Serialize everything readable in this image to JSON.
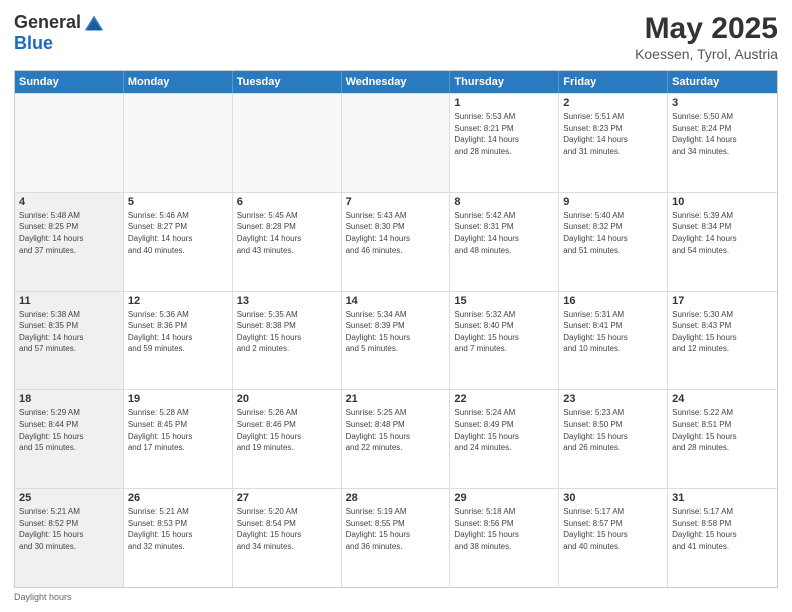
{
  "header": {
    "logo_general": "General",
    "logo_blue": "Blue",
    "main_title": "May 2025",
    "subtitle": "Koessen, Tyrol, Austria"
  },
  "weekdays": [
    "Sunday",
    "Monday",
    "Tuesday",
    "Wednesday",
    "Thursday",
    "Friday",
    "Saturday"
  ],
  "weeks": [
    [
      {
        "day": "",
        "info": "",
        "shaded": true
      },
      {
        "day": "",
        "info": "",
        "shaded": true
      },
      {
        "day": "",
        "info": "",
        "shaded": true
      },
      {
        "day": "",
        "info": "",
        "shaded": true
      },
      {
        "day": "1",
        "info": "Sunrise: 5:53 AM\nSunset: 8:21 PM\nDaylight: 14 hours\nand 28 minutes.",
        "shaded": false
      },
      {
        "day": "2",
        "info": "Sunrise: 5:51 AM\nSunset: 8:23 PM\nDaylight: 14 hours\nand 31 minutes.",
        "shaded": false
      },
      {
        "day": "3",
        "info": "Sunrise: 5:50 AM\nSunset: 8:24 PM\nDaylight: 14 hours\nand 34 minutes.",
        "shaded": false
      }
    ],
    [
      {
        "day": "4",
        "info": "Sunrise: 5:48 AM\nSunset: 8:25 PM\nDaylight: 14 hours\nand 37 minutes.",
        "shaded": true
      },
      {
        "day": "5",
        "info": "Sunrise: 5:46 AM\nSunset: 8:27 PM\nDaylight: 14 hours\nand 40 minutes.",
        "shaded": false
      },
      {
        "day": "6",
        "info": "Sunrise: 5:45 AM\nSunset: 8:28 PM\nDaylight: 14 hours\nand 43 minutes.",
        "shaded": false
      },
      {
        "day": "7",
        "info": "Sunrise: 5:43 AM\nSunset: 8:30 PM\nDaylight: 14 hours\nand 46 minutes.",
        "shaded": false
      },
      {
        "day": "8",
        "info": "Sunrise: 5:42 AM\nSunset: 8:31 PM\nDaylight: 14 hours\nand 48 minutes.",
        "shaded": false
      },
      {
        "day": "9",
        "info": "Sunrise: 5:40 AM\nSunset: 8:32 PM\nDaylight: 14 hours\nand 51 minutes.",
        "shaded": false
      },
      {
        "day": "10",
        "info": "Sunrise: 5:39 AM\nSunset: 8:34 PM\nDaylight: 14 hours\nand 54 minutes.",
        "shaded": false
      }
    ],
    [
      {
        "day": "11",
        "info": "Sunrise: 5:38 AM\nSunset: 8:35 PM\nDaylight: 14 hours\nand 57 minutes.",
        "shaded": true
      },
      {
        "day": "12",
        "info": "Sunrise: 5:36 AM\nSunset: 8:36 PM\nDaylight: 14 hours\nand 59 minutes.",
        "shaded": false
      },
      {
        "day": "13",
        "info": "Sunrise: 5:35 AM\nSunset: 8:38 PM\nDaylight: 15 hours\nand 2 minutes.",
        "shaded": false
      },
      {
        "day": "14",
        "info": "Sunrise: 5:34 AM\nSunset: 8:39 PM\nDaylight: 15 hours\nand 5 minutes.",
        "shaded": false
      },
      {
        "day": "15",
        "info": "Sunrise: 5:32 AM\nSunset: 8:40 PM\nDaylight: 15 hours\nand 7 minutes.",
        "shaded": false
      },
      {
        "day": "16",
        "info": "Sunrise: 5:31 AM\nSunset: 8:41 PM\nDaylight: 15 hours\nand 10 minutes.",
        "shaded": false
      },
      {
        "day": "17",
        "info": "Sunrise: 5:30 AM\nSunset: 8:43 PM\nDaylight: 15 hours\nand 12 minutes.",
        "shaded": false
      }
    ],
    [
      {
        "day": "18",
        "info": "Sunrise: 5:29 AM\nSunset: 8:44 PM\nDaylight: 15 hours\nand 15 minutes.",
        "shaded": true
      },
      {
        "day": "19",
        "info": "Sunrise: 5:28 AM\nSunset: 8:45 PM\nDaylight: 15 hours\nand 17 minutes.",
        "shaded": false
      },
      {
        "day": "20",
        "info": "Sunrise: 5:26 AM\nSunset: 8:46 PM\nDaylight: 15 hours\nand 19 minutes.",
        "shaded": false
      },
      {
        "day": "21",
        "info": "Sunrise: 5:25 AM\nSunset: 8:48 PM\nDaylight: 15 hours\nand 22 minutes.",
        "shaded": false
      },
      {
        "day": "22",
        "info": "Sunrise: 5:24 AM\nSunset: 8:49 PM\nDaylight: 15 hours\nand 24 minutes.",
        "shaded": false
      },
      {
        "day": "23",
        "info": "Sunrise: 5:23 AM\nSunset: 8:50 PM\nDaylight: 15 hours\nand 26 minutes.",
        "shaded": false
      },
      {
        "day": "24",
        "info": "Sunrise: 5:22 AM\nSunset: 8:51 PM\nDaylight: 15 hours\nand 28 minutes.",
        "shaded": false
      }
    ],
    [
      {
        "day": "25",
        "info": "Sunrise: 5:21 AM\nSunset: 8:52 PM\nDaylight: 15 hours\nand 30 minutes.",
        "shaded": true
      },
      {
        "day": "26",
        "info": "Sunrise: 5:21 AM\nSunset: 8:53 PM\nDaylight: 15 hours\nand 32 minutes.",
        "shaded": false
      },
      {
        "day": "27",
        "info": "Sunrise: 5:20 AM\nSunset: 8:54 PM\nDaylight: 15 hours\nand 34 minutes.",
        "shaded": false
      },
      {
        "day": "28",
        "info": "Sunrise: 5:19 AM\nSunset: 8:55 PM\nDaylight: 15 hours\nand 36 minutes.",
        "shaded": false
      },
      {
        "day": "29",
        "info": "Sunrise: 5:18 AM\nSunset: 8:56 PM\nDaylight: 15 hours\nand 38 minutes.",
        "shaded": false
      },
      {
        "day": "30",
        "info": "Sunrise: 5:17 AM\nSunset: 8:57 PM\nDaylight: 15 hours\nand 40 minutes.",
        "shaded": false
      },
      {
        "day": "31",
        "info": "Sunrise: 5:17 AM\nSunset: 8:58 PM\nDaylight: 15 hours\nand 41 minutes.",
        "shaded": false
      }
    ]
  ],
  "footer": "Daylight hours"
}
